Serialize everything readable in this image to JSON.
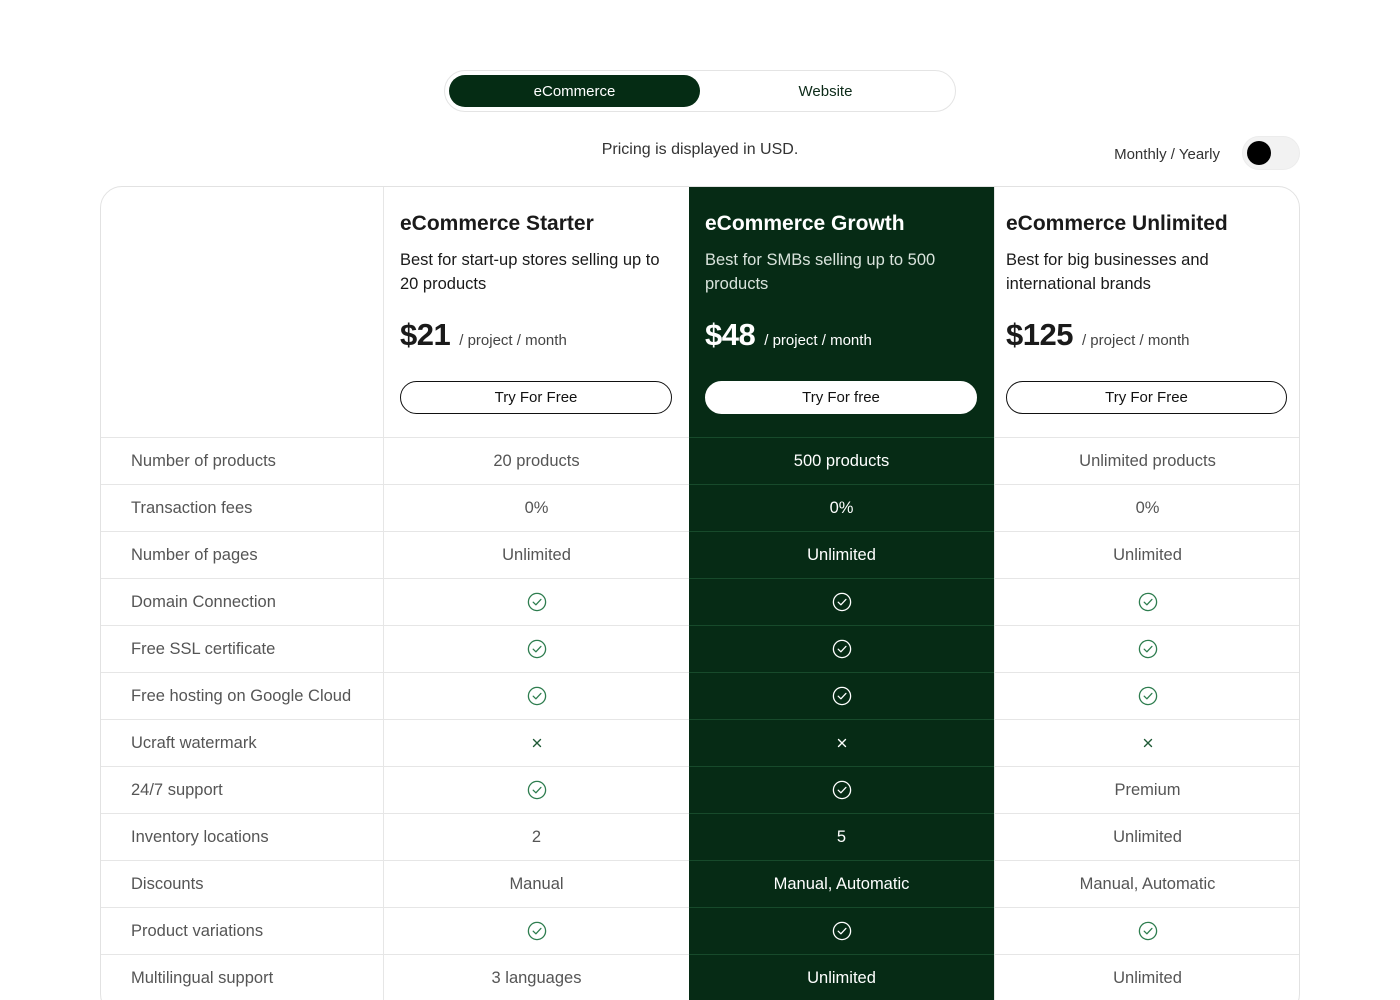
{
  "plan_type_toggle": {
    "options": [
      "eCommerce",
      "Website"
    ],
    "selected": "eCommerce"
  },
  "currency_note": "Pricing is displayed in USD.",
  "billing_toggle": {
    "label": "Monthly / Yearly",
    "state": "monthly"
  },
  "colors": {
    "brand_dark": "#052c14",
    "check_green": "#2e7d4f"
  },
  "plans": [
    {
      "name": "eCommerce Starter",
      "description": "Best for start-up stores selling up to 20 products",
      "price": "$21",
      "period": "/ project / month",
      "cta": "Try For Free"
    },
    {
      "name": "eCommerce Growth",
      "description": "Best for SMBs selling up to 500 products",
      "price": "$48",
      "period": "/ project / month",
      "cta": "Try For free"
    },
    {
      "name": "eCommerce Unlimited",
      "description": "Best for big businesses and international brands",
      "price": "$125",
      "period": "/ project / month",
      "cta": "Try For Free"
    }
  ],
  "features": [
    {
      "label": "Number of products",
      "values": [
        "20 products",
        "500 products",
        "Unlimited products"
      ]
    },
    {
      "label": "Transaction fees",
      "values": [
        "0%",
        "0%",
        "0%"
      ]
    },
    {
      "label": "Number of pages",
      "values": [
        "Unlimited",
        "Unlimited",
        "Unlimited"
      ]
    },
    {
      "label": "Domain Connection",
      "values": [
        "check-icon",
        "check-icon",
        "check-icon"
      ]
    },
    {
      "label": "Free SSL certificate",
      "values": [
        "check-icon",
        "check-icon",
        "check-icon"
      ]
    },
    {
      "label": "Free hosting on Google Cloud",
      "values": [
        "check-icon",
        "check-icon",
        "check-icon"
      ]
    },
    {
      "label": "Ucraft watermark",
      "values": [
        "cross-icon",
        "cross-icon",
        "cross-icon"
      ]
    },
    {
      "label": "24/7 support",
      "values": [
        "check-icon",
        "check-icon",
        "Premium"
      ]
    },
    {
      "label": "Inventory locations",
      "values": [
        "2",
        "5",
        "Unlimited"
      ]
    },
    {
      "label": "Discounts",
      "values": [
        "Manual",
        "Manual, Automatic",
        "Manual, Automatic"
      ]
    },
    {
      "label": "Product variations",
      "values": [
        "check-icon",
        "check-icon",
        "check-icon"
      ]
    },
    {
      "label": "Multilingual support",
      "values": [
        "3 languages",
        "Unlimited",
        "Unlimited"
      ]
    }
  ]
}
